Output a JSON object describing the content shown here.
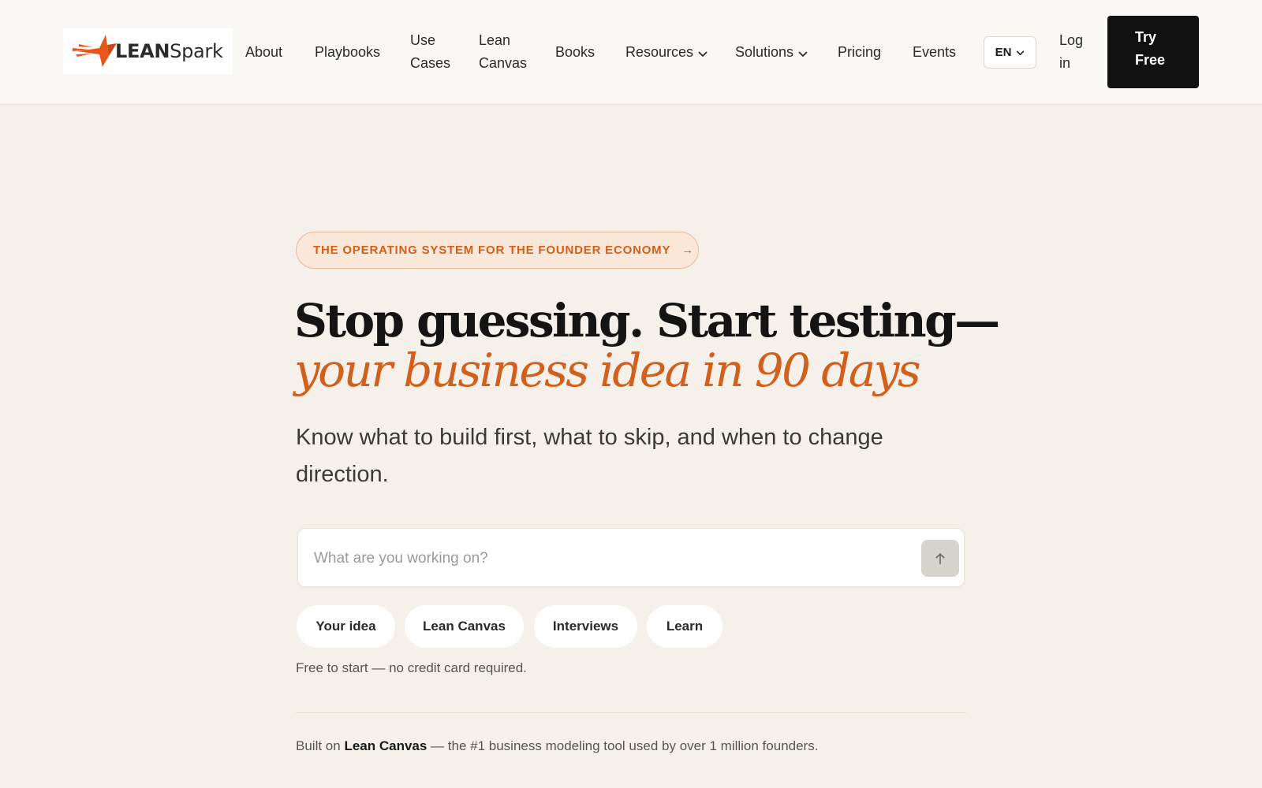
{
  "brand": {
    "logo_lean": "LEAN",
    "logo_spark": "Spark",
    "accent": "#d2601a"
  },
  "nav": {
    "items": [
      {
        "id": "about",
        "label": "About"
      },
      {
        "id": "playbooks",
        "label": "Playbooks"
      },
      {
        "id": "use-cases",
        "line1": "Use",
        "line2": "Cases"
      },
      {
        "id": "lean-canvas",
        "line1": "Lean",
        "line2": "Canvas"
      },
      {
        "id": "books",
        "label": "Books"
      },
      {
        "id": "resources",
        "label": "Resources",
        "dropdown": true
      },
      {
        "id": "solutions",
        "label": "Solutions",
        "dropdown": true
      },
      {
        "id": "pricing",
        "label": "Pricing"
      },
      {
        "id": "events",
        "label": "Events"
      }
    ],
    "language": "EN",
    "login_line1": "Log",
    "login_line2": "in",
    "cta_line1": "Try",
    "cta_line2": "Free"
  },
  "hero": {
    "eyebrow": "THE OPERATING SYSTEM FOR THE FOUNDER ECONOMY",
    "eyebrow_arrow": "→",
    "headline": "Stop guessing. Start testing—",
    "headline_accent": "your business idea in 90 days",
    "subheadline": "Know what to build first, what to skip, and when to change direction."
  },
  "prompt": {
    "placeholder": "What are you working on?",
    "value": ""
  },
  "chips": [
    "Your idea",
    "Lean Canvas",
    "Interviews",
    "Learn"
  ],
  "note": "Free to start — no credit card required.",
  "built_on": {
    "prefix": "Built on ",
    "highlight": "Lean Canvas",
    "suffix": " — the #1 business modeling tool used by over 1 million founders."
  }
}
